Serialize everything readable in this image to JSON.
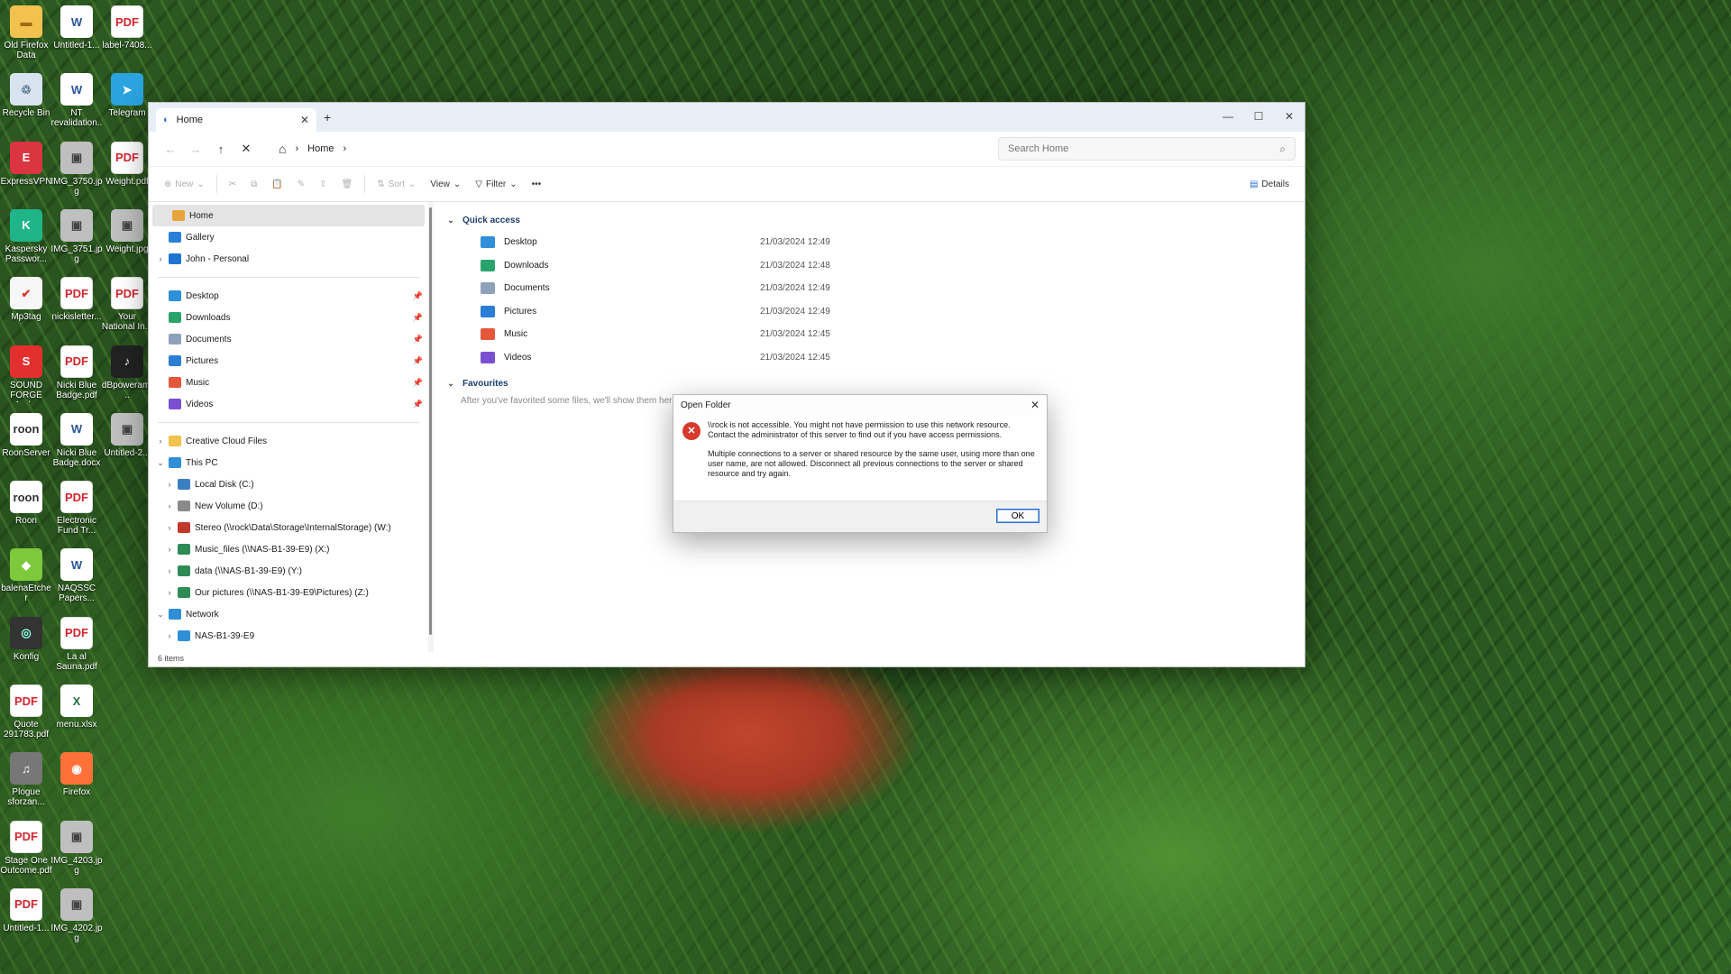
{
  "desktop": {
    "icons": [
      {
        "label": "Old Firefox Data",
        "type": "folder",
        "glyph": "▬"
      },
      {
        "label": "Untitled-1...",
        "type": "word",
        "glyph": "W"
      },
      {
        "label": "label-7408...",
        "type": "pdf",
        "glyph": "PDF"
      },
      {
        "label": "Recycle Bin",
        "type": "bin",
        "glyph": "♲"
      },
      {
        "label": "NT revalidation...",
        "type": "word",
        "glyph": "W"
      },
      {
        "label": "Telegram",
        "type": "tele",
        "glyph": "➤"
      },
      {
        "label": "ExpressVPN",
        "type": "vpn",
        "glyph": "E"
      },
      {
        "label": "IMG_3750.jpg",
        "type": "img",
        "glyph": "▣"
      },
      {
        "label": "Weight.pdf",
        "type": "pdf",
        "glyph": "PDF"
      },
      {
        "label": "Kaspersky Passwor...",
        "type": "kas",
        "glyph": "K"
      },
      {
        "label": "IMG_3751.jpg",
        "type": "img",
        "glyph": "▣"
      },
      {
        "label": "Weight.jpg",
        "type": "img",
        "glyph": "▣"
      },
      {
        "label": "Mp3tag",
        "type": "mp3",
        "glyph": "✔"
      },
      {
        "label": "nickisletter...",
        "type": "pdf",
        "glyph": "PDF"
      },
      {
        "label": "Your National In...",
        "type": "pdf",
        "glyph": "PDF"
      },
      {
        "label": "SOUND FORGE Aud...",
        "type": "sf",
        "glyph": "S"
      },
      {
        "label": "Nicki Blue Badge.pdf",
        "type": "pdf",
        "glyph": "PDF"
      },
      {
        "label": "dBpoweram...",
        "type": "db",
        "glyph": "♪"
      },
      {
        "label": "RoonServer",
        "type": "roon",
        "glyph": "roon"
      },
      {
        "label": "Nicki Blue Badge.docx",
        "type": "word",
        "glyph": "W"
      },
      {
        "label": "Untitled-2...",
        "type": "img",
        "glyph": "▣"
      },
      {
        "label": "Roon",
        "type": "roon",
        "glyph": "roon"
      },
      {
        "label": "Electronic Fund Tr...",
        "type": "pdf",
        "glyph": "PDF"
      },
      {
        "label": "",
        "type": "none",
        "glyph": ""
      },
      {
        "label": "balenaEtcher",
        "type": "bal",
        "glyph": "◆"
      },
      {
        "label": "NAQSSC Papers...",
        "type": "word",
        "glyph": "W"
      },
      {
        "label": "",
        "type": "none",
        "glyph": ""
      },
      {
        "label": "Konfig",
        "type": "kon",
        "glyph": "◎"
      },
      {
        "label": "La al Sauna.pdf",
        "type": "pdf",
        "glyph": "PDF"
      },
      {
        "label": "",
        "type": "none",
        "glyph": ""
      },
      {
        "label": "Quote 291783.pdf",
        "type": "pdf",
        "glyph": "PDF"
      },
      {
        "label": "menu.xlsx",
        "type": "xls",
        "glyph": "X"
      },
      {
        "label": "",
        "type": "none",
        "glyph": ""
      },
      {
        "label": "Plogue sforzan...",
        "type": "plog",
        "glyph": "♫"
      },
      {
        "label": "Firefox",
        "type": "ff",
        "glyph": "◉"
      },
      {
        "label": "",
        "type": "none",
        "glyph": ""
      },
      {
        "label": "Stage One Outcome.pdf",
        "type": "pdf",
        "glyph": "PDF"
      },
      {
        "label": "IMG_4203.jpg",
        "type": "img",
        "glyph": "▣"
      },
      {
        "label": "",
        "type": "none",
        "glyph": ""
      },
      {
        "label": "Untitled-1...",
        "type": "pdf",
        "glyph": "PDF"
      },
      {
        "label": "IMG_4202.jpg",
        "type": "img",
        "glyph": "▣"
      }
    ]
  },
  "window": {
    "tab_title": "Home",
    "new_tab": "+",
    "controls": {
      "minimize": "—",
      "maximize": "☐",
      "close": "✕"
    },
    "nav": {
      "back": "←",
      "forward": "→",
      "up": "↑",
      "stop": "✕"
    },
    "address": {
      "home_icon": "⌂",
      "sep": "›",
      "location": "Home"
    },
    "search": {
      "placeholder": "Search Home",
      "icon": "⌕"
    },
    "toolbar": {
      "new": "New",
      "sort": "Sort",
      "view": "View",
      "filter": "Filter",
      "more": "•••",
      "details": "Details",
      "cut": "✂",
      "copy": "⧉",
      "paste": "📋",
      "rename": "✎",
      "share": "⇪",
      "delete": "🗑"
    },
    "sidebar": {
      "top": [
        {
          "label": "Home",
          "color": "#e8a33a",
          "selected": true,
          "chev": ""
        },
        {
          "label": "Gallery",
          "color": "#2c7fd6",
          "chev": ""
        },
        {
          "label": "John - Personal",
          "color": "#1f74d1",
          "chev": "›"
        }
      ],
      "pinned": [
        {
          "label": "Desktop",
          "color": "#2f8fd8"
        },
        {
          "label": "Downloads",
          "color": "#2aa36a"
        },
        {
          "label": "Documents",
          "color": "#8da2b8"
        },
        {
          "label": "Pictures",
          "color": "#2c7fd6"
        },
        {
          "label": "Music",
          "color": "#e4573b"
        },
        {
          "label": "Videos",
          "color": "#7b4fd1"
        }
      ],
      "pin_glyph": "📌",
      "tree": [
        {
          "label": "Creative Cloud Files",
          "color": "#f2c14e",
          "chev": "›",
          "indent": 0
        },
        {
          "label": "This PC",
          "color": "#2f8fd8",
          "chev": "⌄",
          "indent": 0
        },
        {
          "label": "Local Disk (C:)",
          "color": "#3a7fc1",
          "chev": "›",
          "indent": 1
        },
        {
          "label": "New Volume (D:)",
          "color": "#8a8a8a",
          "chev": "›",
          "indent": 1
        },
        {
          "label": "Stereo (\\\\rock\\Data\\Storage\\InternalStorage) (W:)",
          "color": "#c0392b",
          "chev": "›",
          "indent": 1
        },
        {
          "label": "Music_files (\\\\NAS-B1-39-E9) (X:)",
          "color": "#2e8b57",
          "chev": "›",
          "indent": 1
        },
        {
          "label": "data (\\\\NAS-B1-39-E9) (Y:)",
          "color": "#2e8b57",
          "chev": "›",
          "indent": 1
        },
        {
          "label": "Our pictures (\\\\NAS-B1-39-E9\\Pictures) (Z:)",
          "color": "#2e8b57",
          "chev": "›",
          "indent": 1
        },
        {
          "label": "Network",
          "color": "#2f8fd8",
          "chev": "⌄",
          "indent": 0
        },
        {
          "label": "NAS-B1-39-E9",
          "color": "#2f8fd8",
          "chev": "›",
          "indent": 1
        }
      ]
    },
    "content": {
      "quick_access_title": "Quick access",
      "items": [
        {
          "name": "Desktop",
          "date": "21/03/2024 12:49",
          "color": "#2f8fd8"
        },
        {
          "name": "Downloads",
          "date": "21/03/2024 12:48",
          "color": "#2aa36a"
        },
        {
          "name": "Documents",
          "date": "21/03/2024 12:49",
          "color": "#8da2b8"
        },
        {
          "name": "Pictures",
          "date": "21/03/2024 12:49",
          "color": "#2c7fd6"
        },
        {
          "name": "Music",
          "date": "21/03/2024 12:45",
          "color": "#e4573b"
        },
        {
          "name": "Videos",
          "date": "21/03/2024 12:45",
          "color": "#7b4fd1"
        }
      ],
      "favourites_title": "Favourites",
      "favourites_note": "After you've favorited some files, we'll show them here."
    },
    "status": "6 items"
  },
  "dialog": {
    "title": "Open Folder",
    "close": "✕",
    "error_glyph": "✕",
    "message1": "\\\\rock is not accessible. You might not have permission to use this network resource. Contact the administrator of this server to find out if you have access permissions.",
    "message2": "Multiple connections to a server or shared resource by the same user, using more than one user name, are not allowed. Disconnect all previous connections to the server or shared resource and try again.",
    "ok": "OK"
  }
}
